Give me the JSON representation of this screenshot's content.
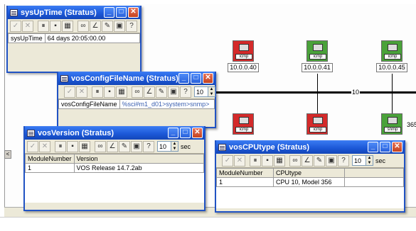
{
  "network_map": {
    "nodes": [
      {
        "ip": "10.0.0.40",
        "status_color": "#d42a2a",
        "icon": "host-snmp-icon",
        "tag": "icmp"
      },
      {
        "ip": "10.0.0.41",
        "status_color": "#4aa23a",
        "icon": "host-snmp-icon",
        "tag": "icmp"
      },
      {
        "ip": "10.0.0.45",
        "status_color": "#4aa23a",
        "icon": "host-snmp-icon",
        "tag": "icmp"
      },
      {
        "ip": "",
        "status_color": "#d42a2a",
        "icon": "host-snmp-icon",
        "tag": "icmp"
      },
      {
        "ip": "",
        "status_color": "#d42a2a",
        "icon": "host-snmp-icon",
        "tag": "icmp"
      },
      {
        "ip": "",
        "status_color": "#4aa23a",
        "icon": "host-snmp-icon",
        "tag": "snmp"
      }
    ],
    "segment_label": "10",
    "partial_label": "365"
  },
  "windows": {
    "sysuptime": {
      "title": "sysUpTime (Stratus)",
      "row": {
        "label": "sysUpTime",
        "value": "64 days 20:05:00.00"
      }
    },
    "vosconfig": {
      "title": "vosConfigFileName (Stratus)",
      "interval": "10",
      "row": {
        "label": "vosConfigFileName",
        "value": "%sci#m1_d01>system>snmp>"
      }
    },
    "vosversion": {
      "title": "vosVersion (Stratus)",
      "interval": "10",
      "unit": "sec",
      "columns": [
        "ModuleNumber",
        "Version"
      ],
      "rows": [
        [
          "1",
          "VOS Release 14.7.2ab"
        ]
      ]
    },
    "voscpu": {
      "title": "vosCPUtype (Stratus)",
      "interval": "10",
      "unit": "sec",
      "columns": [
        "ModuleNumber",
        "CPUtype"
      ],
      "rows": [
        [
          "1",
          "CPU 10, Model 356"
        ]
      ]
    }
  },
  "toolbar_icons": [
    "check-icon",
    "cancel-icon",
    "pause-icon",
    "record-icon",
    "chart-icon",
    "binoculars-icon",
    "graph-icon",
    "edit-icon",
    "save-icon",
    "help-icon"
  ],
  "colors": {
    "titlebar": "#1b57d6",
    "window_bg": "#ece9d8",
    "node_down": "#d42a2a",
    "node_up": "#4aa23a"
  }
}
